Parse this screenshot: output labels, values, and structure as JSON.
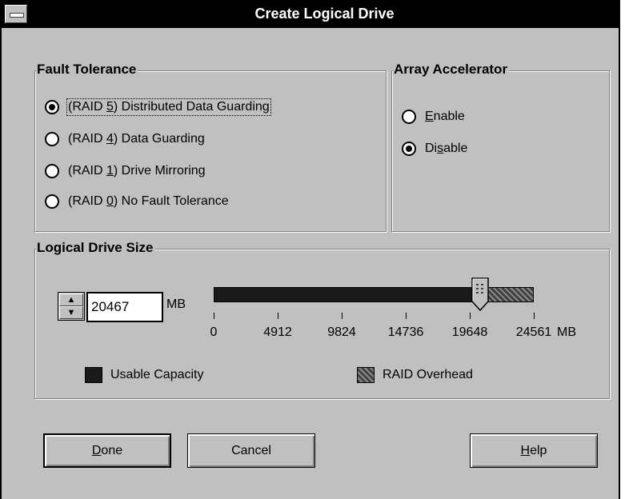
{
  "window": {
    "title": "Create Logical Drive"
  },
  "fault_tolerance": {
    "label": "Fault Tolerance",
    "options": [
      {
        "pre": "(RAID ",
        "key": "5",
        "post": ") Distributed Data Guarding",
        "checked": true
      },
      {
        "pre": "(RAID ",
        "key": "4",
        "post": ") Data Guarding",
        "checked": false
      },
      {
        "pre": "(RAID ",
        "key": "1",
        "post": ") Drive Mirroring",
        "checked": false
      },
      {
        "pre": "(RAID ",
        "key": "0",
        "post": ") No Fault Tolerance",
        "checked": false
      }
    ]
  },
  "array_accelerator": {
    "label": "Array Accelerator",
    "enable": {
      "pre": "",
      "key": "E",
      "post": "nable",
      "checked": false
    },
    "disable": {
      "pre": "Di",
      "key": "s",
      "post": "able",
      "checked": true
    }
  },
  "drive_size": {
    "label": "Logical Drive Size",
    "value": "20467",
    "unit": "MB",
    "slider_max": 24561,
    "slider_value": 20467,
    "ticks": [
      "0",
      "4912",
      "9824",
      "14736",
      "19648",
      "24561"
    ],
    "tick_unit": "MB",
    "legend_usable": "Usable Capacity",
    "legend_overhead": "RAID Overhead",
    "spin_up_glyph": "▲",
    "spin_down_glyph": "▼"
  },
  "buttons": {
    "done": {
      "pre": "",
      "key": "D",
      "post": "one"
    },
    "cancel": "Cancel",
    "help": {
      "pre": "",
      "key": "H",
      "post": "elp"
    }
  },
  "colors": {
    "dialog_bg": "#c0c0c0",
    "titlebar_bg": "#000000",
    "usable": "#1a1a1a",
    "overhead": "#606060"
  }
}
